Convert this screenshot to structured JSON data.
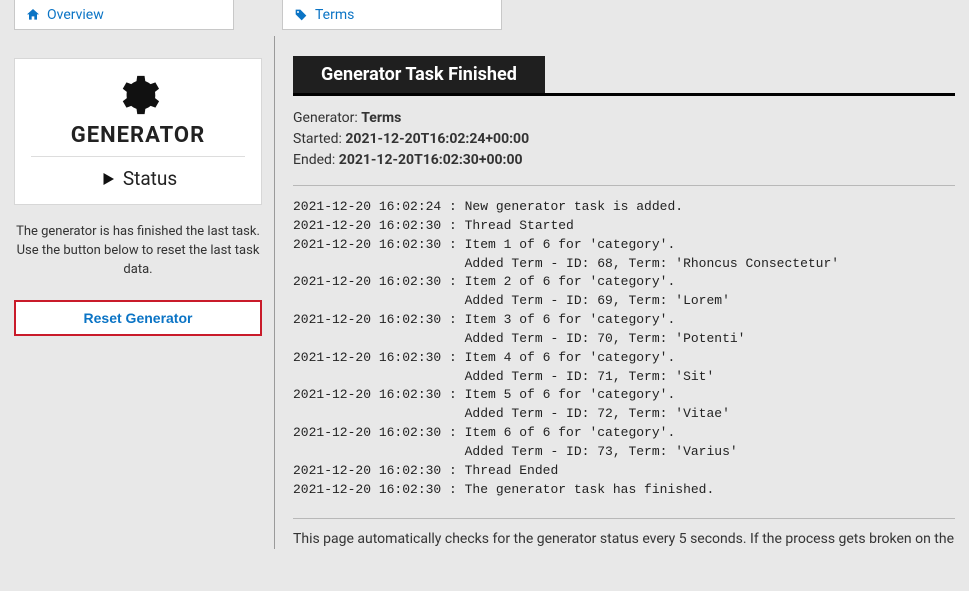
{
  "tabs": {
    "overview": "Overview",
    "terms": "Terms"
  },
  "sidebar": {
    "title": "GENERATOR",
    "status_label": "Status",
    "description": "The generator is has finished the last task. Use the button below to reset the last task data.",
    "reset_button": "Reset Generator"
  },
  "header": {
    "title": "Generator Task Finished"
  },
  "meta": {
    "generator_label": "Generator:",
    "generator_value": "Terms",
    "started_label": "Started:",
    "started_value": "2021-12-20T16:02:24+00:00",
    "ended_label": "Ended:",
    "ended_value": "2021-12-20T16:02:30+00:00"
  },
  "log_lines": [
    "2021-12-20 16:02:24 : New generator task is added.",
    "2021-12-20 16:02:30 : Thread Started",
    "2021-12-20 16:02:30 : Item 1 of 6 for 'category'.",
    "                      Added Term - ID: 68, Term: 'Rhoncus Consectetur'",
    "2021-12-20 16:02:30 : Item 2 of 6 for 'category'.",
    "                      Added Term - ID: 69, Term: 'Lorem'",
    "2021-12-20 16:02:30 : Item 3 of 6 for 'category'.",
    "                      Added Term - ID: 70, Term: 'Potenti'",
    "2021-12-20 16:02:30 : Item 4 of 6 for 'category'.",
    "                      Added Term - ID: 71, Term: 'Sit'",
    "2021-12-20 16:02:30 : Item 5 of 6 for 'category'.",
    "                      Added Term - ID: 72, Term: 'Vitae'",
    "2021-12-20 16:02:30 : Item 6 of 6 for 'category'.",
    "                      Added Term - ID: 73, Term: 'Varius'",
    "2021-12-20 16:02:30 : Thread Ended",
    "2021-12-20 16:02:30 : The generator task has finished."
  ],
  "footer_note": "This page automatically checks for the generator status every 5 seconds. If the process gets broken on the server side, the page will attempt auto-recovery."
}
